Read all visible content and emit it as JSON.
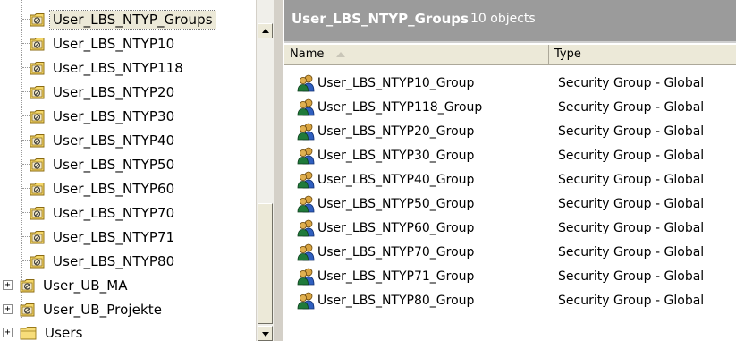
{
  "tree": {
    "items": [
      {
        "label": "User_LBS_NTYP_Groups",
        "icon": "ou-icon",
        "selected": true
      },
      {
        "label": "User_LBS_NTYP10",
        "icon": "ou-icon"
      },
      {
        "label": "User_LBS_NTYP118",
        "icon": "ou-icon"
      },
      {
        "label": "User_LBS_NTYP20",
        "icon": "ou-icon"
      },
      {
        "label": "User_LBS_NTYP30",
        "icon": "ou-icon"
      },
      {
        "label": "User_LBS_NTYP40",
        "icon": "ou-icon"
      },
      {
        "label": "User_LBS_NTYP50",
        "icon": "ou-icon"
      },
      {
        "label": "User_LBS_NTYP60",
        "icon": "ou-icon"
      },
      {
        "label": "User_LBS_NTYP70",
        "icon": "ou-icon"
      },
      {
        "label": "User_LBS_NTYP71",
        "icon": "ou-icon"
      },
      {
        "label": "User_LBS_NTYP80",
        "icon": "ou-icon"
      },
      {
        "label": "User_UB_MA",
        "icon": "ou-icon",
        "expander": "+"
      },
      {
        "label": "User_UB_Projekte",
        "icon": "ou-icon",
        "expander": "+"
      },
      {
        "label": "Users",
        "icon": "folder-icon",
        "expander": "+"
      }
    ]
  },
  "details": {
    "title": "User_LBS_NTYP_Groups",
    "count": "10 objects",
    "columns": {
      "name": "Name",
      "type": "Type"
    },
    "rows": [
      {
        "name": "User_LBS_NTYP10_Group",
        "type": "Security Group - Global"
      },
      {
        "name": "User_LBS_NTYP118_Group",
        "type": "Security Group - Global"
      },
      {
        "name": "User_LBS_NTYP20_Group",
        "type": "Security Group - Global"
      },
      {
        "name": "User_LBS_NTYP30_Group",
        "type": "Security Group - Global"
      },
      {
        "name": "User_LBS_NTYP40_Group",
        "type": "Security Group - Global"
      },
      {
        "name": "User_LBS_NTYP50_Group",
        "type": "Security Group - Global"
      },
      {
        "name": "User_LBS_NTYP60_Group",
        "type": "Security Group - Global"
      },
      {
        "name": "User_LBS_NTYP70_Group",
        "type": "Security Group - Global"
      },
      {
        "name": "User_LBS_NTYP71_Group",
        "type": "Security Group - Global"
      },
      {
        "name": "User_LBS_NTYP80_Group",
        "type": "Security Group - Global"
      }
    ]
  },
  "colors": {
    "banner": "#9b9b9b",
    "header": "#ece9d8",
    "selection": "#ece9d8"
  }
}
